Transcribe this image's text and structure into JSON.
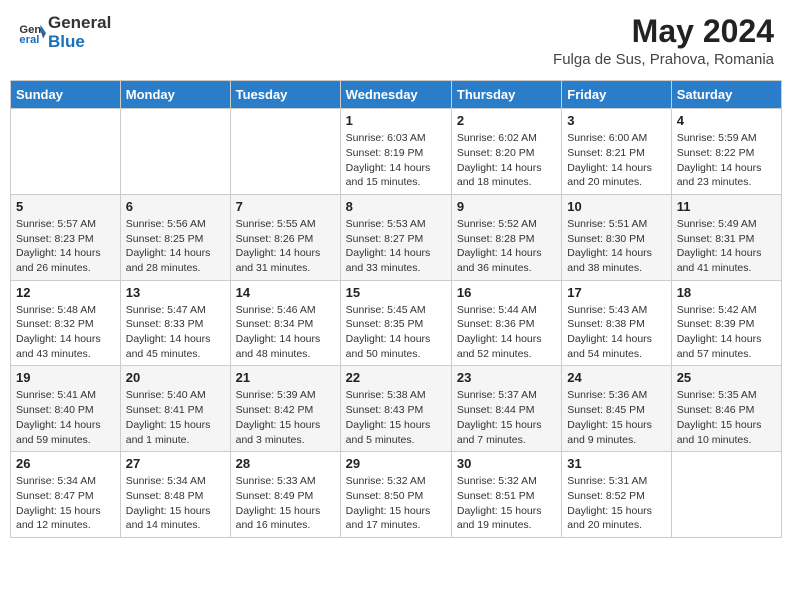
{
  "logo": {
    "line1": "General",
    "line2": "Blue"
  },
  "title": "May 2024",
  "subtitle": "Fulga de Sus, Prahova, Romania",
  "days_of_week": [
    "Sunday",
    "Monday",
    "Tuesday",
    "Wednesday",
    "Thursday",
    "Friday",
    "Saturday"
  ],
  "weeks": [
    [
      {
        "day": "",
        "detail": ""
      },
      {
        "day": "",
        "detail": ""
      },
      {
        "day": "",
        "detail": ""
      },
      {
        "day": "1",
        "detail": "Sunrise: 6:03 AM\nSunset: 8:19 PM\nDaylight: 14 hours\nand 15 minutes."
      },
      {
        "day": "2",
        "detail": "Sunrise: 6:02 AM\nSunset: 8:20 PM\nDaylight: 14 hours\nand 18 minutes."
      },
      {
        "day": "3",
        "detail": "Sunrise: 6:00 AM\nSunset: 8:21 PM\nDaylight: 14 hours\nand 20 minutes."
      },
      {
        "day": "4",
        "detail": "Sunrise: 5:59 AM\nSunset: 8:22 PM\nDaylight: 14 hours\nand 23 minutes."
      }
    ],
    [
      {
        "day": "5",
        "detail": "Sunrise: 5:57 AM\nSunset: 8:23 PM\nDaylight: 14 hours\nand 26 minutes."
      },
      {
        "day": "6",
        "detail": "Sunrise: 5:56 AM\nSunset: 8:25 PM\nDaylight: 14 hours\nand 28 minutes."
      },
      {
        "day": "7",
        "detail": "Sunrise: 5:55 AM\nSunset: 8:26 PM\nDaylight: 14 hours\nand 31 minutes."
      },
      {
        "day": "8",
        "detail": "Sunrise: 5:53 AM\nSunset: 8:27 PM\nDaylight: 14 hours\nand 33 minutes."
      },
      {
        "day": "9",
        "detail": "Sunrise: 5:52 AM\nSunset: 8:28 PM\nDaylight: 14 hours\nand 36 minutes."
      },
      {
        "day": "10",
        "detail": "Sunrise: 5:51 AM\nSunset: 8:30 PM\nDaylight: 14 hours\nand 38 minutes."
      },
      {
        "day": "11",
        "detail": "Sunrise: 5:49 AM\nSunset: 8:31 PM\nDaylight: 14 hours\nand 41 minutes."
      }
    ],
    [
      {
        "day": "12",
        "detail": "Sunrise: 5:48 AM\nSunset: 8:32 PM\nDaylight: 14 hours\nand 43 minutes."
      },
      {
        "day": "13",
        "detail": "Sunrise: 5:47 AM\nSunset: 8:33 PM\nDaylight: 14 hours\nand 45 minutes."
      },
      {
        "day": "14",
        "detail": "Sunrise: 5:46 AM\nSunset: 8:34 PM\nDaylight: 14 hours\nand 48 minutes."
      },
      {
        "day": "15",
        "detail": "Sunrise: 5:45 AM\nSunset: 8:35 PM\nDaylight: 14 hours\nand 50 minutes."
      },
      {
        "day": "16",
        "detail": "Sunrise: 5:44 AM\nSunset: 8:36 PM\nDaylight: 14 hours\nand 52 minutes."
      },
      {
        "day": "17",
        "detail": "Sunrise: 5:43 AM\nSunset: 8:38 PM\nDaylight: 14 hours\nand 54 minutes."
      },
      {
        "day": "18",
        "detail": "Sunrise: 5:42 AM\nSunset: 8:39 PM\nDaylight: 14 hours\nand 57 minutes."
      }
    ],
    [
      {
        "day": "19",
        "detail": "Sunrise: 5:41 AM\nSunset: 8:40 PM\nDaylight: 14 hours\nand 59 minutes."
      },
      {
        "day": "20",
        "detail": "Sunrise: 5:40 AM\nSunset: 8:41 PM\nDaylight: 15 hours\nand 1 minute."
      },
      {
        "day": "21",
        "detail": "Sunrise: 5:39 AM\nSunset: 8:42 PM\nDaylight: 15 hours\nand 3 minutes."
      },
      {
        "day": "22",
        "detail": "Sunrise: 5:38 AM\nSunset: 8:43 PM\nDaylight: 15 hours\nand 5 minutes."
      },
      {
        "day": "23",
        "detail": "Sunrise: 5:37 AM\nSunset: 8:44 PM\nDaylight: 15 hours\nand 7 minutes."
      },
      {
        "day": "24",
        "detail": "Sunrise: 5:36 AM\nSunset: 8:45 PM\nDaylight: 15 hours\nand 9 minutes."
      },
      {
        "day": "25",
        "detail": "Sunrise: 5:35 AM\nSunset: 8:46 PM\nDaylight: 15 hours\nand 10 minutes."
      }
    ],
    [
      {
        "day": "26",
        "detail": "Sunrise: 5:34 AM\nSunset: 8:47 PM\nDaylight: 15 hours\nand 12 minutes."
      },
      {
        "day": "27",
        "detail": "Sunrise: 5:34 AM\nSunset: 8:48 PM\nDaylight: 15 hours\nand 14 minutes."
      },
      {
        "day": "28",
        "detail": "Sunrise: 5:33 AM\nSunset: 8:49 PM\nDaylight: 15 hours\nand 16 minutes."
      },
      {
        "day": "29",
        "detail": "Sunrise: 5:32 AM\nSunset: 8:50 PM\nDaylight: 15 hours\nand 17 minutes."
      },
      {
        "day": "30",
        "detail": "Sunrise: 5:32 AM\nSunset: 8:51 PM\nDaylight: 15 hours\nand 19 minutes."
      },
      {
        "day": "31",
        "detail": "Sunrise: 5:31 AM\nSunset: 8:52 PM\nDaylight: 15 hours\nand 20 minutes."
      },
      {
        "day": "",
        "detail": ""
      }
    ]
  ]
}
